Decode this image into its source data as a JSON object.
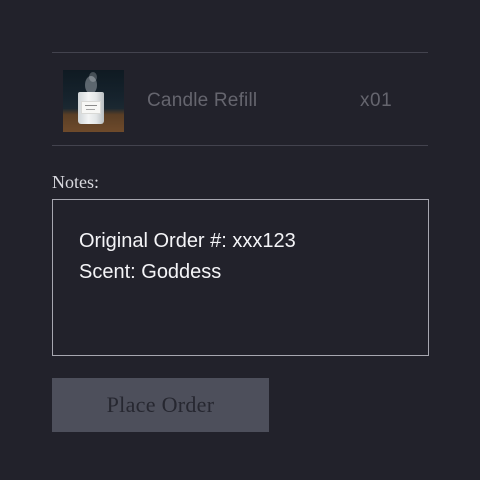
{
  "order_item": {
    "image_icon": "candle-jar-photo",
    "name": "Candle Refill",
    "quantity": "x01"
  },
  "notes": {
    "label": "Notes:",
    "value_line1": "Original Order #: xxx123",
    "value_line2": "Scent: Goddess"
  },
  "actions": {
    "place_order_label": "Place Order"
  },
  "colors": {
    "background": "#22222b",
    "divider": "#43434e",
    "button_bg": "#4d4f5b",
    "notes_text": "#f4f4f7",
    "muted_text": "#65656e"
  }
}
